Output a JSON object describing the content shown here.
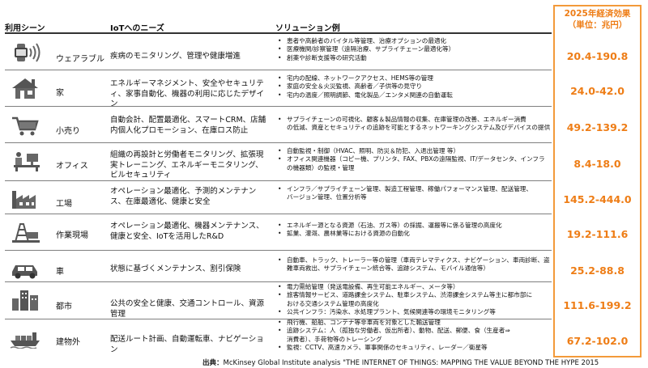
{
  "headers": {
    "scene": "利用シーン",
    "needs": "IoTへのニーズ",
    "solutions": "ソリューション例",
    "econ_line1": "2025年経済効果",
    "econ_line2": "（単位：兆円）"
  },
  "rows": [
    {
      "scene": "ウェアラブル",
      "icon": "wearable-icon",
      "needs": "疾病のモニタリング、管理や健康増進",
      "solutions": [
        "患者や高齢者のバイタル等管理、治療オプションの最適化",
        "医療機関/診察管理（遠隔治療、サプライチェーン最適化等）",
        "創薬や診断支援等の研究活動"
      ],
      "value": "20.4-190.8"
    },
    {
      "scene": "家",
      "icon": "house-icon",
      "needs": "エネルギーマネジメント、安全やセキュリティ、家事自動化、機器の利用に応じたデザイン",
      "solutions": [
        "宅内の配線、ネットワークアクセス、HEMS等の管理",
        "家庭の安全＆火災監視、高齢者／子供等の見守り",
        "宅内の温度／照明調節、電化製品／エンタメ関連の自動運転"
      ],
      "value": "24.0-42.0"
    },
    {
      "scene": "小売り",
      "icon": "shopping-cart-icon",
      "needs": "自動会計、配置最適化、スマートCRM、店舗内個人化プロモーション、在庫ロス防止",
      "solutions": [
        "サプライチェーンの可視化、顧客＆製品情報の収集、在庫管理の改善、エネルギー消費",
        "の低減、資産とセキュリティの追跡を可能とするネットワーキングシステム及びデバイスの提供"
      ],
      "value": "49.2-139.2"
    },
    {
      "scene": "オフィス",
      "icon": "office-desk-icon",
      "needs": "組織の再設計と労働者モニタリング、拡張現実トレーニング、エネルギーモニタリング、ビルセキュリティ",
      "solutions": [
        "自動監視・制御（HVAC、照明、防災＆防犯、入退出管理 等）",
        "オフィス関連機器（コピー機、プリンタ、FAX、PBXの遠隔監視、IT/データセンタ、インフラ",
        "の機器類）の監視・管理"
      ],
      "value": "8.4-18.0"
    },
    {
      "scene": "工場",
      "icon": "factory-icon",
      "needs": "オペレーション最適化、予測的メンテナンス、在庫最適化、健康と安全",
      "solutions": [
        "インフラ／サプライチェーン管理、製造工程管理、稼働パフォーマンス管理、配送管理、",
        "バージョン管理、位置分析等"
      ],
      "value": "145.2-444.0"
    },
    {
      "scene": "作業現場",
      "icon": "oil-rig-icon",
      "needs": "オペレーション最適化、機器メンテナンス、健康と安全、IoTを活用したR&D",
      "solutions": [
        "エネルギー源となる資源（石油、ガス等）の採掘、運搬等に係る管理の高度化",
        "鉱業、灌漑、農林業等における資源の自動化"
      ],
      "value": "19.2-111.6"
    },
    {
      "scene": "車",
      "icon": "car-icon",
      "needs": "状態に基づくメンテナンス、割引保険",
      "solutions": [
        "自動車、トラック、トレーラー等の管理（車両テレマティクス、ナビゲーション、車両診断、盗",
        "難車両救出、サプライチェーン統合等、追跡システム、モバイル通信等）"
      ],
      "value": "25.2-88.8"
    },
    {
      "scene": "都市",
      "icon": "city-buildings-icon",
      "needs": "公共の安全と健康、交通コントロール、資源管理",
      "solutions": [
        "電力需給管理（発送電設備、再生可能エネルギー、メータ等）",
        "旅客情報サービス、道路課金システム、駐車システム、渋滞課金システム等主に都市部に",
        "おける交通システム管理の高度化",
        "公共インフラ：汚染水、水処理プラント、気候関連等の環境モニタリング等"
      ],
      "value": "111.6-199.2"
    },
    {
      "scene": "建物外",
      "icon": "cargo-ship-icon",
      "needs": "配送ルート計画、自動運転車、ナビゲーション",
      "solutions": [
        "飛行機、船舶、コンテナ等非車両を対象とした輸送管理",
        "追跡システム：人（孤独な労働者、仮出所者）、動物、配送、郵便、食（生産者⇒",
        "消費者）、手荷物等のトレーシング",
        "監視：CCTV、高速カメラ、軍事関係のセキュリティ、レーダー／衛星等"
      ],
      "value": "67.2-102.0"
    }
  ],
  "source_label": "出典：",
  "source_text": "McKinsey Global Institute analysis \"THE INTERNET OF THINGS: MAPPING THE VALUE BEYOND THE HYPE 2015"
}
